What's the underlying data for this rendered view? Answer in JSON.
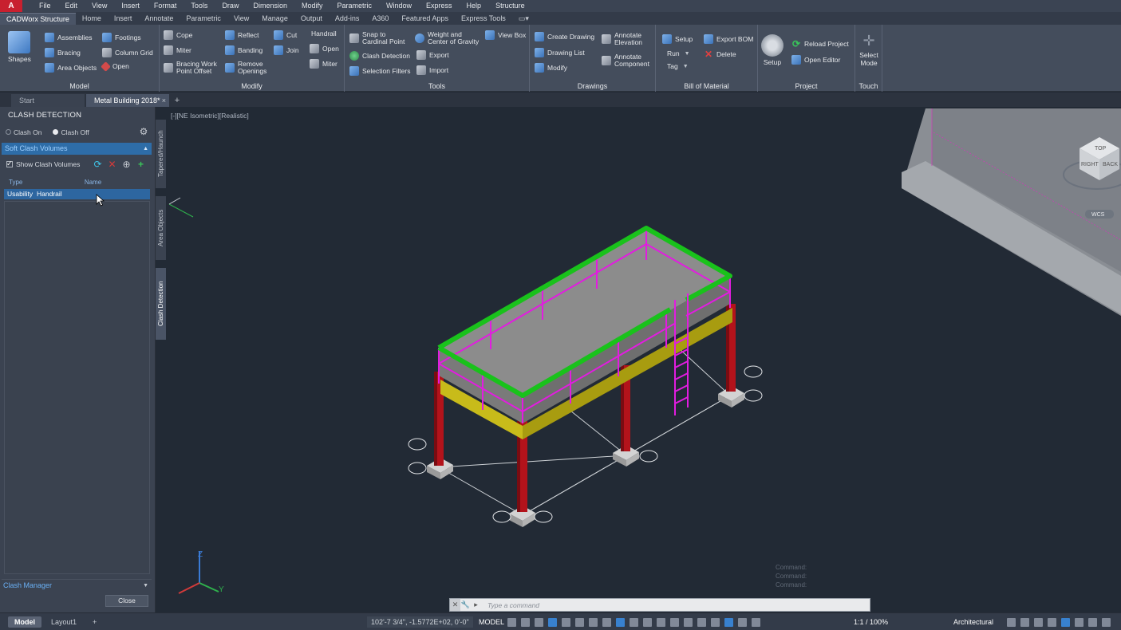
{
  "menu": [
    "File",
    "Edit",
    "View",
    "Insert",
    "Format",
    "Tools",
    "Draw",
    "Dimension",
    "Modify",
    "Parametric",
    "Window",
    "Express",
    "Help",
    "Structure"
  ],
  "ribbon_tabs": [
    "CADWorx Structure",
    "Home",
    "Insert",
    "Annotate",
    "Parametric",
    "View",
    "Manage",
    "Output",
    "Add-ins",
    "A360",
    "Featured Apps",
    "Express Tools"
  ],
  "ribbon": {
    "model": {
      "title": "Model",
      "shapes": "Shapes",
      "assemblies": "Assemblies",
      "bracing": "Bracing",
      "area_objects": "Area Objects",
      "footings": "Footings",
      "column_grid": "Column Grid",
      "open": "Open"
    },
    "modify": {
      "title": "Modify",
      "cope": "Cope",
      "miter": "Miter",
      "bracing_work": "Bracing Work",
      "point_offset": "Point Offset",
      "reflect": "Reflect",
      "banding": "Banding",
      "remove": "Remove",
      "openings": "Openings",
      "cut": "Cut",
      "join": "Join",
      "handrail": "Handrail",
      "open": "Open",
      "miter2": "Miter"
    },
    "tools": {
      "title": "Tools",
      "snap_to": "Snap to",
      "cardinal_point": "Cardinal Point",
      "clash_detection": "Clash Detection",
      "selection_filters": "Selection Filters",
      "weight_and": "Weight and",
      "center_of_gravity": "Center of Gravity",
      "export": "Export",
      "import": "Import",
      "view_box": "View Box"
    },
    "drawings": {
      "title": "Drawings",
      "create_drawing": "Create Drawing",
      "drawing_list": "Drawing List",
      "modify": "Modify",
      "annotate_elev_1": "Annotate",
      "annotate_elev_2": "Elevation",
      "annotate_comp_1": "Annotate",
      "annotate_comp_2": "Component"
    },
    "bom": {
      "title": "Bill of Material",
      "setup": "Setup",
      "run": "Run",
      "tag": "Tag",
      "export_bom": "Export BOM",
      "delete": "Delete"
    },
    "project": {
      "title": "Project",
      "setup": "Setup",
      "reload_project": "Reload Project",
      "open_editor": "Open Editor"
    },
    "touch": {
      "title": "Touch",
      "select_1": "Select",
      "select_2": "Mode"
    }
  },
  "doc_tabs": [
    "Start",
    "Metal Building 2018*"
  ],
  "palette": {
    "title": "CLASH DETECTION",
    "clash_on": "Clash On",
    "clash_off": "Clash Off",
    "section": "Soft Clash Volumes",
    "show_volumes": "Show Clash Volumes",
    "col_type": "Type",
    "col_name": "Name",
    "row_type": "Usability",
    "row_name": "Handrail",
    "manager": "Clash Manager",
    "close": "Close"
  },
  "side_tabs": [
    "Tapered/Haunch",
    "Area Objects",
    "Clash Detection"
  ],
  "viewport_label": "[-][NE Isometric][Realistic]",
  "viewcube": {
    "top": "TOP",
    "right": "RIGHT",
    "back": "BACK",
    "wcs": "WCS"
  },
  "axes": {
    "z": "Z",
    "y": "Y"
  },
  "command": {
    "placeholder": "Type a command"
  },
  "command_history": [
    "Command:",
    "Command:",
    "Command:"
  ],
  "status": {
    "layouts": [
      "Model",
      "Layout1"
    ],
    "coords": "102'-7 3/4\", -1.5772E+02, 0'-0\"",
    "model": "MODEL",
    "scale": "1:1 / 100%",
    "units": "Architectural"
  },
  "colors": {
    "handrail_top": "#19c21b",
    "rail": "#e21ce0",
    "beam": "#c8bb1a",
    "column": "#b3131b",
    "deck": "#8c8c8c",
    "accent": "#2e6da8"
  }
}
